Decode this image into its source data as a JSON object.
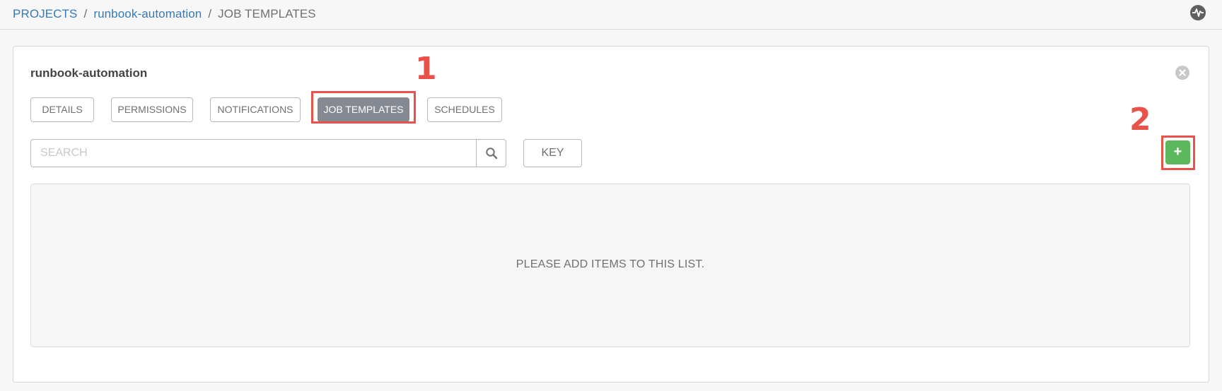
{
  "breadcrumb": {
    "projects": "PROJECTS",
    "separator": "/",
    "project": "runbook-automation",
    "current": "JOB TEMPLATES"
  },
  "header": {
    "activity_icon": "activity-stream-icon"
  },
  "panel": {
    "title": "runbook-automation",
    "close_icon": "close-icon",
    "tabs": [
      {
        "label": "DETAILS",
        "active": false
      },
      {
        "label": "PERMISSIONS",
        "active": false
      },
      {
        "label": "NOTIFICATIONS",
        "active": false
      },
      {
        "label": "JOB TEMPLATES",
        "active": true
      },
      {
        "label": "SCHEDULES",
        "active": false
      }
    ],
    "search": {
      "placeholder": "SEARCH",
      "value": "",
      "icon": "search-icon"
    },
    "key_label": "KEY",
    "add_label": "+",
    "empty_message": "PLEASE ADD ITEMS TO THIS LIST."
  },
  "annotations": {
    "first": "1",
    "second": "2",
    "color": "#e9524a"
  },
  "colors": {
    "link": "#337ab7",
    "active_tab": "#848992",
    "add_button": "#5cb85c"
  }
}
